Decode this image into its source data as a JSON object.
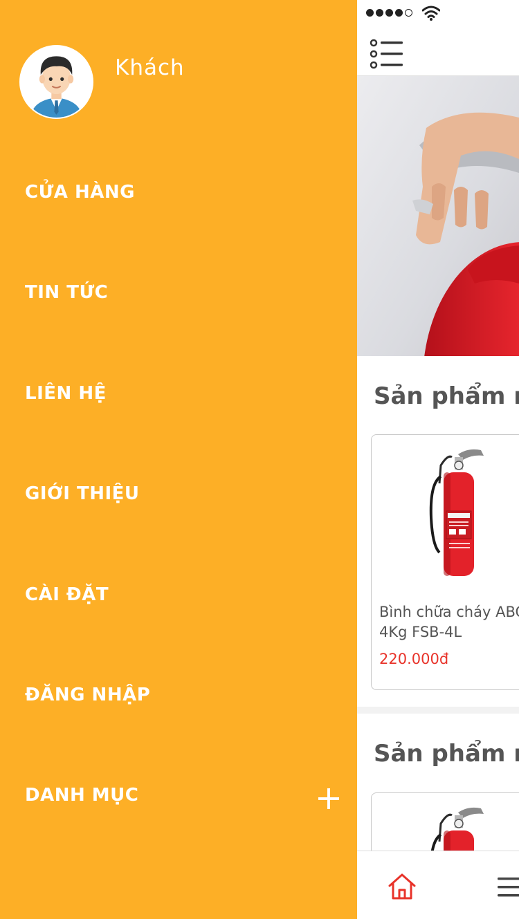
{
  "drawer": {
    "user": {
      "name": "Khách",
      "avatar_icon": "user-avatar"
    },
    "menu": [
      {
        "id": "store",
        "label": "CỬA HÀNG"
      },
      {
        "id": "news",
        "label": "TIN TỨC"
      },
      {
        "id": "contact",
        "label": "LIÊN HỆ"
      },
      {
        "id": "about",
        "label": "GIỚI THIỆU"
      },
      {
        "id": "settings",
        "label": "CÀI ĐẶT"
      },
      {
        "id": "login",
        "label": "ĐĂNG NHẬP"
      },
      {
        "id": "categories",
        "label": "DANH MỤC",
        "expand_icon": "plus-icon"
      }
    ],
    "background_color": "#FDAF26"
  },
  "app": {
    "status_bar": {
      "signal_bars": 4,
      "signal_max": 5,
      "wifi_icon": "wifi-icon"
    },
    "toolbar": {
      "menu_icon": "list-icon"
    },
    "sections": [
      {
        "title": "Sản phẩm n",
        "products": [
          {
            "name_line1": "Bình chữa cháy ABC",
            "name_line2": "4Kg FSB-4L",
            "price": "220.000đ"
          }
        ]
      },
      {
        "title": "Sản phẩm n",
        "products": [
          {
            "name_line1": "",
            "name_line2": "",
            "price": ""
          }
        ]
      }
    ],
    "bottom_nav": {
      "home_icon": "home-icon",
      "menu_icon": "hamburger-icon"
    },
    "colors": {
      "price": "#e8332a",
      "accent": "#e8332a",
      "title": "#555555"
    }
  }
}
